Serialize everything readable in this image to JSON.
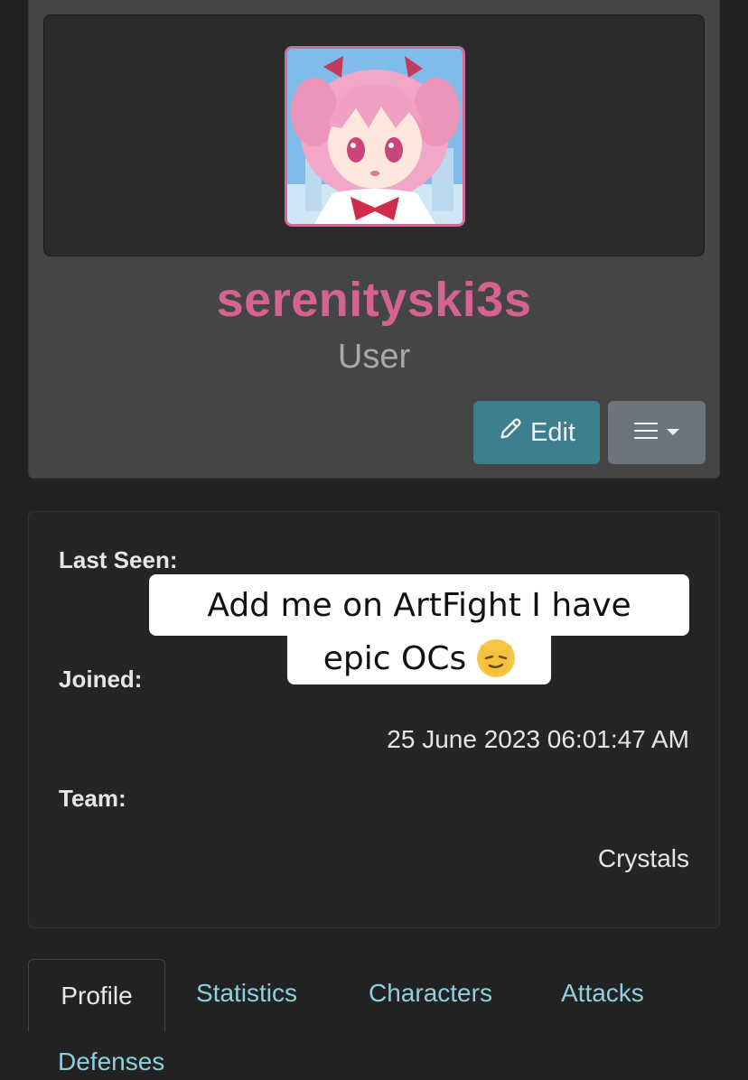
{
  "profile": {
    "username": "serenityski3s",
    "role": "User",
    "edit_label": "Edit",
    "colors": {
      "username": "#d56391",
      "edit_button": "#3c7f8e",
      "menu_button": "#6c757d",
      "tab_link": "#8ecfe0"
    }
  },
  "info": {
    "last_seen_label": "Last Seen:",
    "joined_label": "Joined:",
    "joined_value": "25 June 2023 06:01:47 AM",
    "team_label": "Team:",
    "team_value": "Crystals"
  },
  "caption": {
    "line1": "Add me on ArtFight I have",
    "line2": "epic OCs",
    "emoji": "smirking-cat-emoji"
  },
  "tabs": [
    {
      "label": "Profile",
      "active": true
    },
    {
      "label": "Statistics",
      "active": false
    },
    {
      "label": "Characters",
      "active": false
    },
    {
      "label": "Attacks",
      "active": false
    },
    {
      "label": "Defenses",
      "active": false
    }
  ]
}
